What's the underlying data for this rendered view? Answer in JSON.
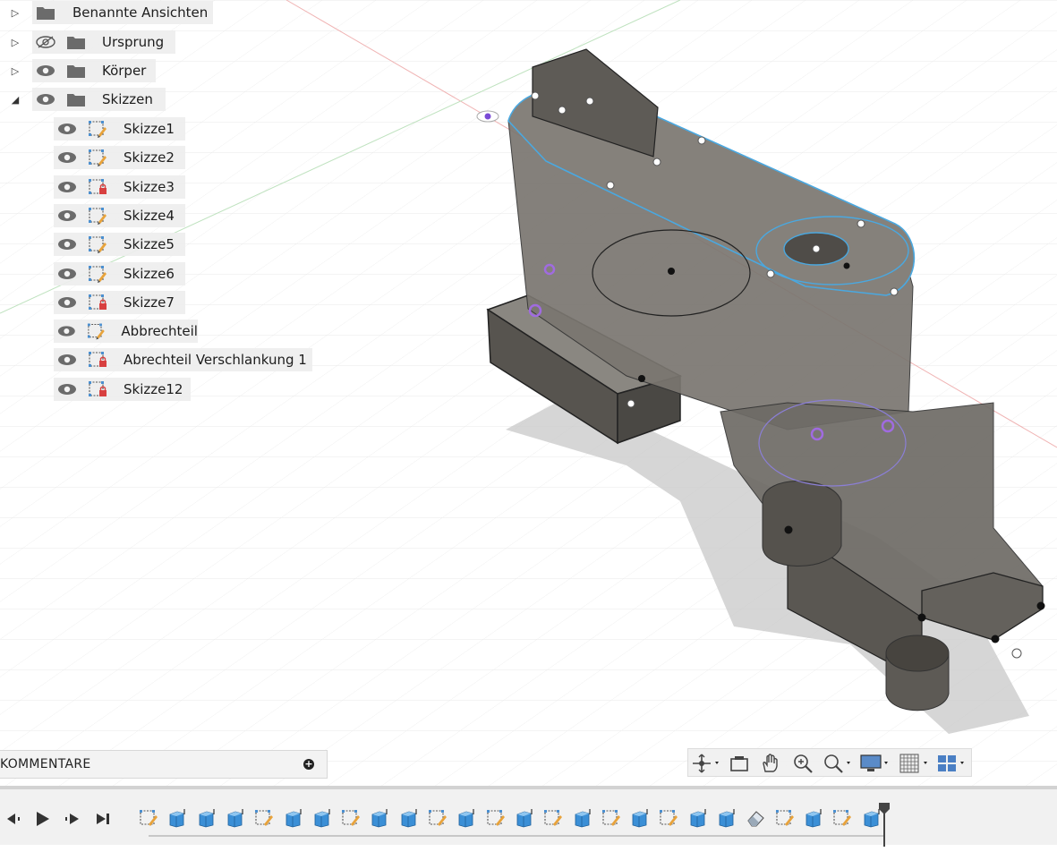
{
  "browser": {
    "items": [
      {
        "label": "Benannte Ansichten",
        "arrow": "▷",
        "eye": "none",
        "icon": "folder-icon"
      },
      {
        "label": "Ursprung",
        "arrow": "▷",
        "eye": "hidden",
        "icon": "folder-icon"
      },
      {
        "label": "Körper",
        "arrow": "▷",
        "eye": "visible",
        "icon": "folder-icon"
      },
      {
        "label": "Skizzen",
        "arrow": "◢",
        "eye": "visible",
        "icon": "folder-icon"
      }
    ],
    "sketches": [
      {
        "label": "Skizze1",
        "icon": "sketch-icon",
        "locked": false
      },
      {
        "label": "Skizze2",
        "icon": "sketch-icon",
        "locked": false
      },
      {
        "label": "Skizze3",
        "icon": "sketch-locked-icon",
        "locked": true
      },
      {
        "label": "Skizze4",
        "icon": "sketch-icon",
        "locked": false
      },
      {
        "label": "Skizze5",
        "icon": "sketch-icon",
        "locked": false
      },
      {
        "label": "Skizze6",
        "icon": "sketch-icon",
        "locked": false
      },
      {
        "label": "Skizze7",
        "icon": "sketch-locked-icon",
        "locked": true
      },
      {
        "label": "Abbrechteil",
        "icon": "sketch-icon",
        "locked": false
      },
      {
        "label": "Abrechteil Verschlankung 1",
        "icon": "sketch-locked-icon",
        "locked": true
      },
      {
        "label": "Skizze12",
        "icon": "sketch-locked-icon",
        "locked": true
      }
    ]
  },
  "comments": {
    "label": "KOMMENTARE",
    "add_icon": "plus-circle-icon"
  },
  "nav_toolbar": {
    "buttons": [
      "orbit-icon",
      "look-at-icon",
      "pan-icon",
      "zoom-window-icon",
      "fit-icon",
      "display-settings-icon",
      "grid-icon",
      "viewports-icon"
    ]
  },
  "timeline": {
    "controls": [
      "go-to-start-icon",
      "previous-step-icon",
      "play-icon",
      "next-step-icon",
      "go-to-end-icon"
    ],
    "features": [
      "sketch",
      "extrude",
      "extrude",
      "extrude",
      "sketch",
      "extrude",
      "extrude",
      "sketch",
      "extrude",
      "extrude",
      "sketch",
      "extrude",
      "sketch",
      "extrude",
      "sketch",
      "extrude",
      "sketch",
      "extrude",
      "sketch",
      "extrude",
      "extrude",
      "eraser",
      "sketch",
      "extrude",
      "sketch",
      "extrude"
    ]
  },
  "colors": {
    "accent_blue": "#4aa8e0",
    "grid": "#e6e6e6",
    "body_fill": "#6d6a64",
    "marker_red": "#d84040"
  }
}
